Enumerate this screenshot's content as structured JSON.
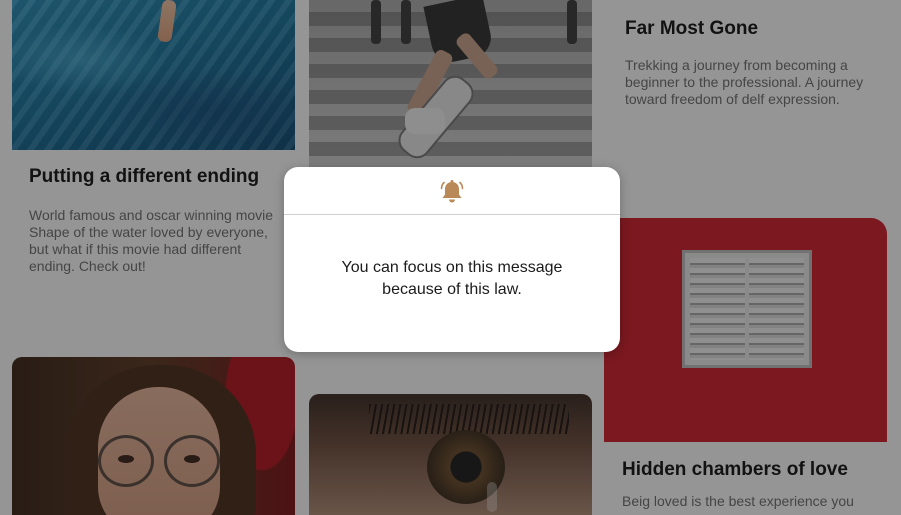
{
  "cards": [
    {
      "title": "Putting a different ending",
      "description": "World famous and oscar winning movie Shape of the water loved by everyone, but what if this movie had different ending. Check out!"
    },
    {
      "title": "Far Most Gone",
      "description": "Trekking a journey from becoming a beginner to the professional. A journey toward freedom of delf expression."
    },
    {
      "title": "Hidden chambers of love",
      "description": "Beig loved is the best experience you"
    }
  ],
  "modal": {
    "icon": "bell-icon",
    "message_line1": "You can focus on this message",
    "message_line2": "because of this law."
  },
  "colors": {
    "overlay": "#141414",
    "bell": "#b98a58",
    "accent_red": "#d01c2a"
  }
}
